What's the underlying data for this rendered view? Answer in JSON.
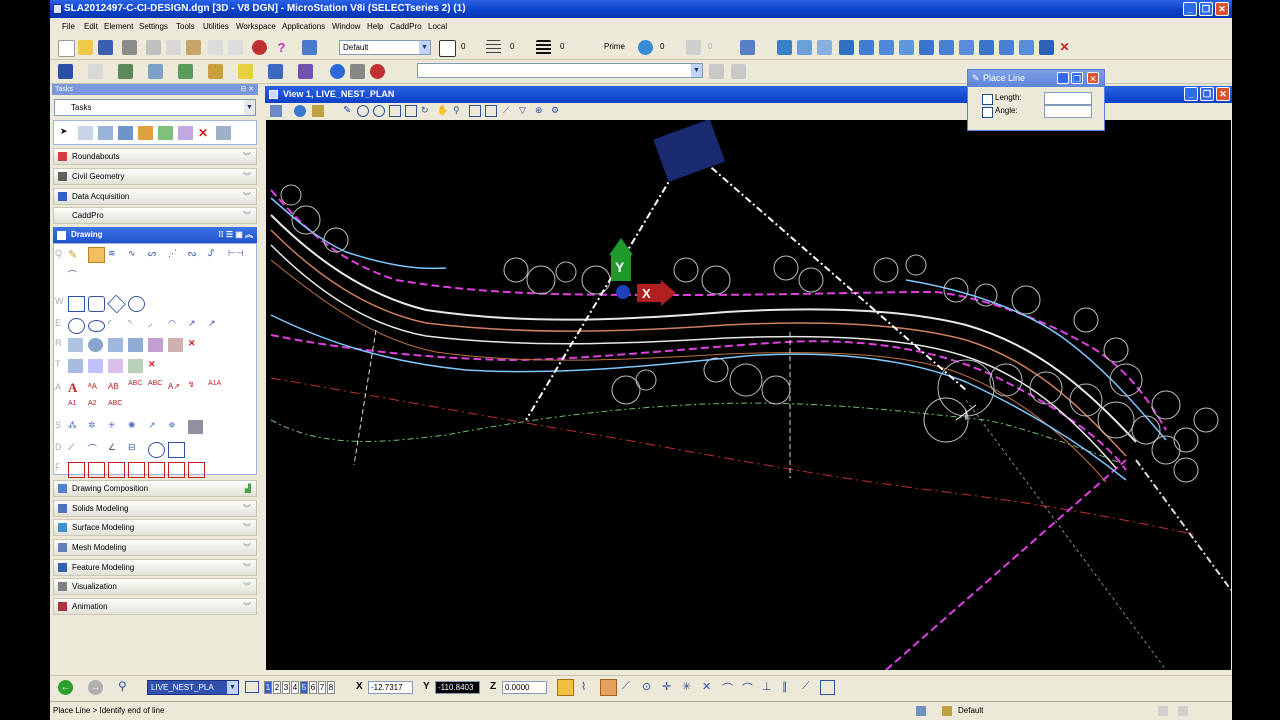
{
  "window": {
    "title": "SLA2012497-C-CI-DESIGN.dgn [3D - V8 DGN] - MicroStation V8i (SELECTseries 2) (1)"
  },
  "menu": [
    "File",
    "Edit",
    "Element",
    "Settings",
    "Tools",
    "Utilities",
    "Workspace",
    "Applications",
    "Window",
    "Help",
    "CaddPro",
    "Local"
  ],
  "attributes": {
    "level": "Default",
    "color": "0",
    "style": "0",
    "weight": "0",
    "priority_label": "Prime",
    "transparency": "0",
    "extra": "0"
  },
  "tasks": {
    "header": "Tasks",
    "selector": "Tasks",
    "panels_top": [
      "Roundabouts",
      "Civil Geometry",
      "Data Acquisition",
      "CaddPro"
    ],
    "drawing_label": "Drawing",
    "panels_bottom": [
      "Drawing Composition",
      "Solids Modeling",
      "Surface Modeling",
      "Mesh Modeling",
      "Feature Modeling",
      "Visualization",
      "Animation"
    ],
    "row_letters": [
      "Q",
      "W",
      "E",
      "R",
      "T",
      "A",
      "S",
      "D",
      "F"
    ]
  },
  "view": {
    "title": "View 1, LIVE_NEST_PLAN"
  },
  "place_line": {
    "title": "Place Line",
    "length_label": "Length:",
    "angle_label": "Angle:"
  },
  "canvas_labels": {
    "y": "Y",
    "x": "X"
  },
  "bottom": {
    "view_combo": "LIVE_NEST_PLA",
    "view_numbers": [
      "1",
      "2",
      "3",
      "4",
      "5",
      "6",
      "7",
      "8"
    ],
    "x_label": "X",
    "x_value": "-12.7317",
    "y_label": "Y",
    "y_value": "-110.8403",
    "z_label": "Z",
    "z_value": "0.0000"
  },
  "status": {
    "prompt": "Place Line > Identify end of line",
    "level": "Default"
  },
  "colors": {
    "title_blue": "#0a3fc6",
    "magenta": "#e040e0",
    "cyan": "#7fc7ff",
    "chrome": "#ece9d8"
  }
}
